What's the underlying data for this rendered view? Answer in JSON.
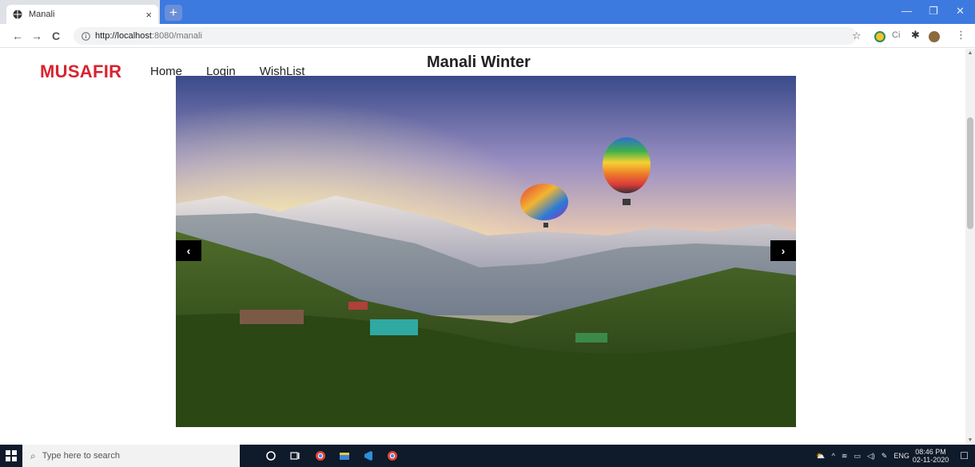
{
  "browser": {
    "tab_title": "Manali",
    "tab_close": "×",
    "new_tab": "+",
    "url_host": "http://localhost",
    "url_rest": ":8080/manali",
    "nav_back": "←",
    "nav_forward": "→",
    "nav_reload": "C",
    "star": "☆",
    "window_min": "—",
    "window_max": "❐",
    "window_close": "✕"
  },
  "site": {
    "brand": "MUSAFIR",
    "nav": [
      "Home",
      "Login",
      "WishList"
    ],
    "page_title": "Manali Winter",
    "carousel": {
      "prev": "‹",
      "next": "›"
    }
  },
  "taskbar": {
    "search_placeholder": "Type here to search",
    "tray_lang": "ENG",
    "time": "08:46 PM",
    "date": "02-11-2020"
  },
  "colors": {
    "brand": "#d9232f",
    "tab_strip": "#3d7ae0",
    "taskbar": "#0f1a2a"
  }
}
